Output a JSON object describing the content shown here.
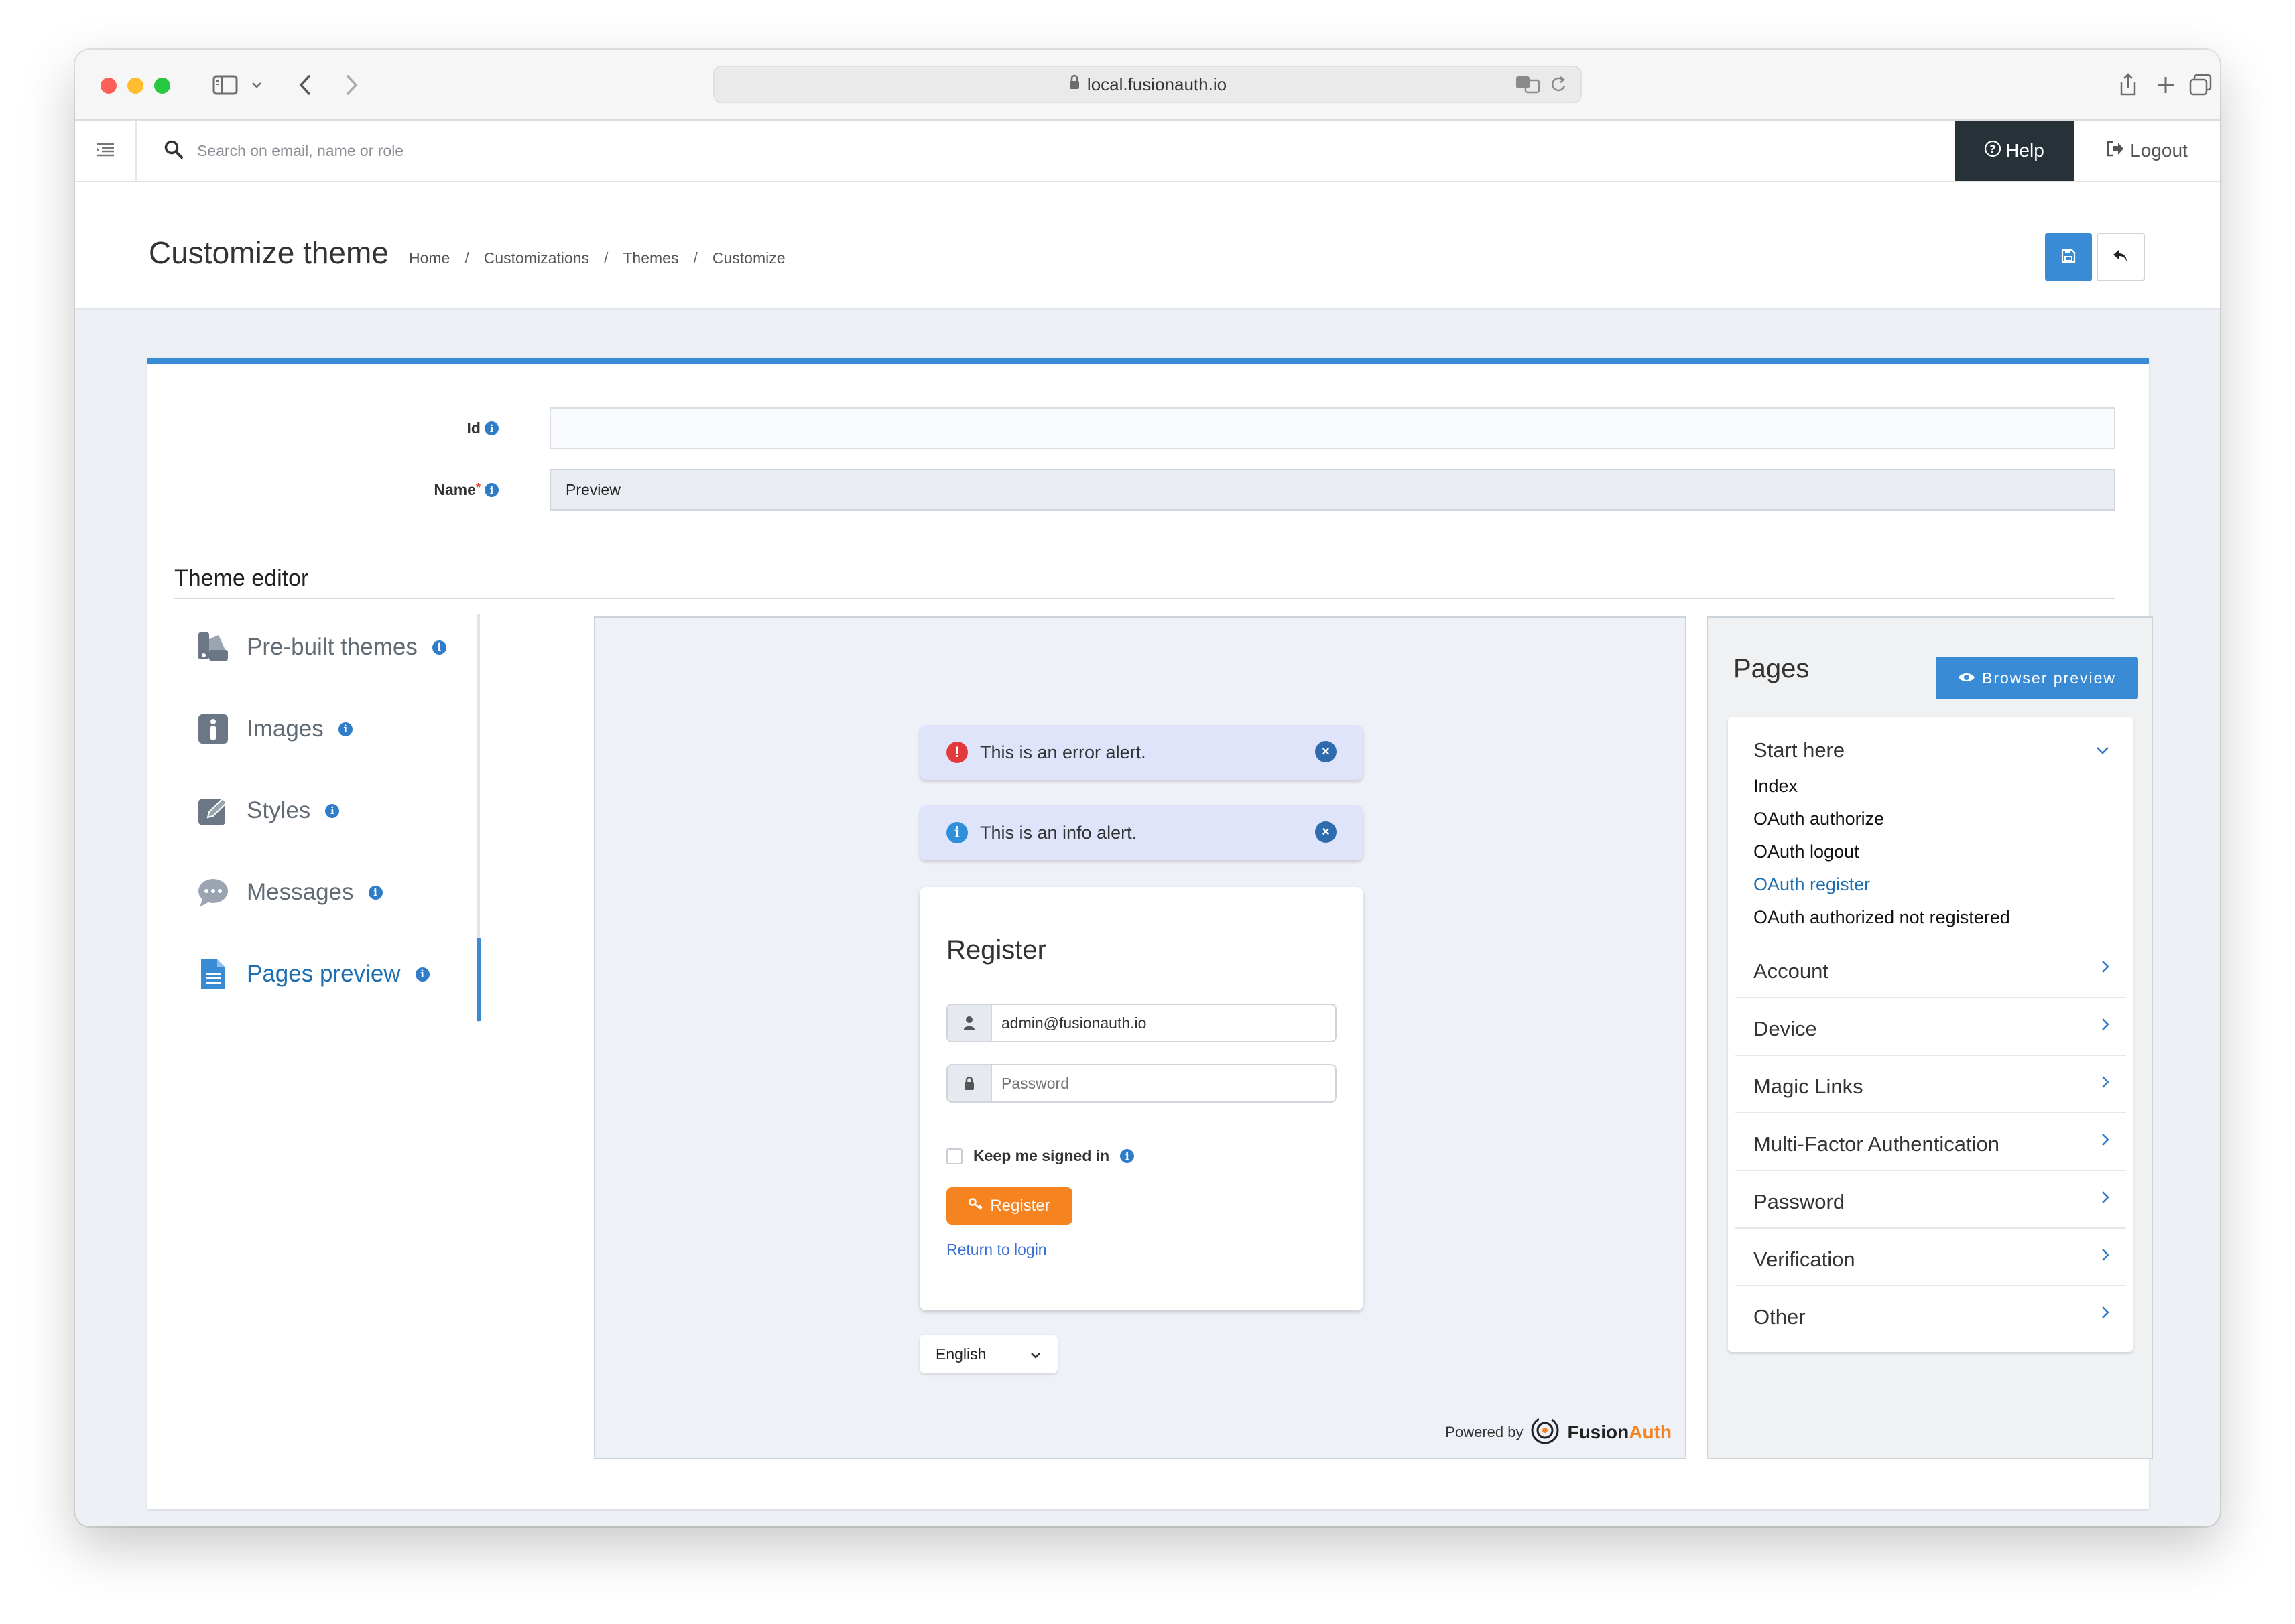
{
  "browser": {
    "url": "local.fusionauth.io"
  },
  "header": {
    "search_placeholder": "Search on email, name or role",
    "help_label": "Help",
    "logout_label": "Logout"
  },
  "page": {
    "title": "Customize theme",
    "breadcrumbs": [
      "Home",
      "Customizations",
      "Themes",
      "Customize"
    ],
    "separator": "/"
  },
  "form": {
    "id_label": "Id",
    "id_value": "",
    "name_label": "Name",
    "required_mark": "*",
    "name_value": "Preview",
    "info_glyph": "i"
  },
  "theme_editor": {
    "title": "Theme editor",
    "nav": [
      {
        "label": "Pre-built themes",
        "icon": "palette-icon"
      },
      {
        "label": "Images",
        "icon": "info-icon"
      },
      {
        "label": "Styles",
        "icon": "pencil-icon"
      },
      {
        "label": "Messages",
        "icon": "chat-icon"
      },
      {
        "label": "Pages preview",
        "icon": "document-icon",
        "active": true
      }
    ]
  },
  "preview": {
    "error_alert": "This is an error alert.",
    "info_alert": "This is an info alert.",
    "card_title": "Register",
    "email_value": "admin@fusionauth.io",
    "password_placeholder": "Password",
    "keep_signed_in": "Keep me signed in",
    "register_button": "Register",
    "return_link": "Return to login",
    "language": "English",
    "powered_by": "Powered by",
    "brand_first": "Fusion",
    "brand_second": "Auth"
  },
  "pages_panel": {
    "title": "Pages",
    "browser_preview": "Browser preview",
    "start_here": {
      "label": "Start here",
      "items": [
        "Index",
        "OAuth authorize",
        "OAuth logout",
        "OAuth register",
        "OAuth authorized not registered"
      ],
      "active_item": "OAuth register"
    },
    "groups": [
      "Account",
      "Device",
      "Magic Links",
      "Multi-Factor Authentication",
      "Password",
      "Verification",
      "Other"
    ]
  },
  "colors": {
    "accent": "#3a8bd6",
    "help_bg": "#263238",
    "register_orange": "#f58320",
    "active_link": "#1f6fb3"
  }
}
